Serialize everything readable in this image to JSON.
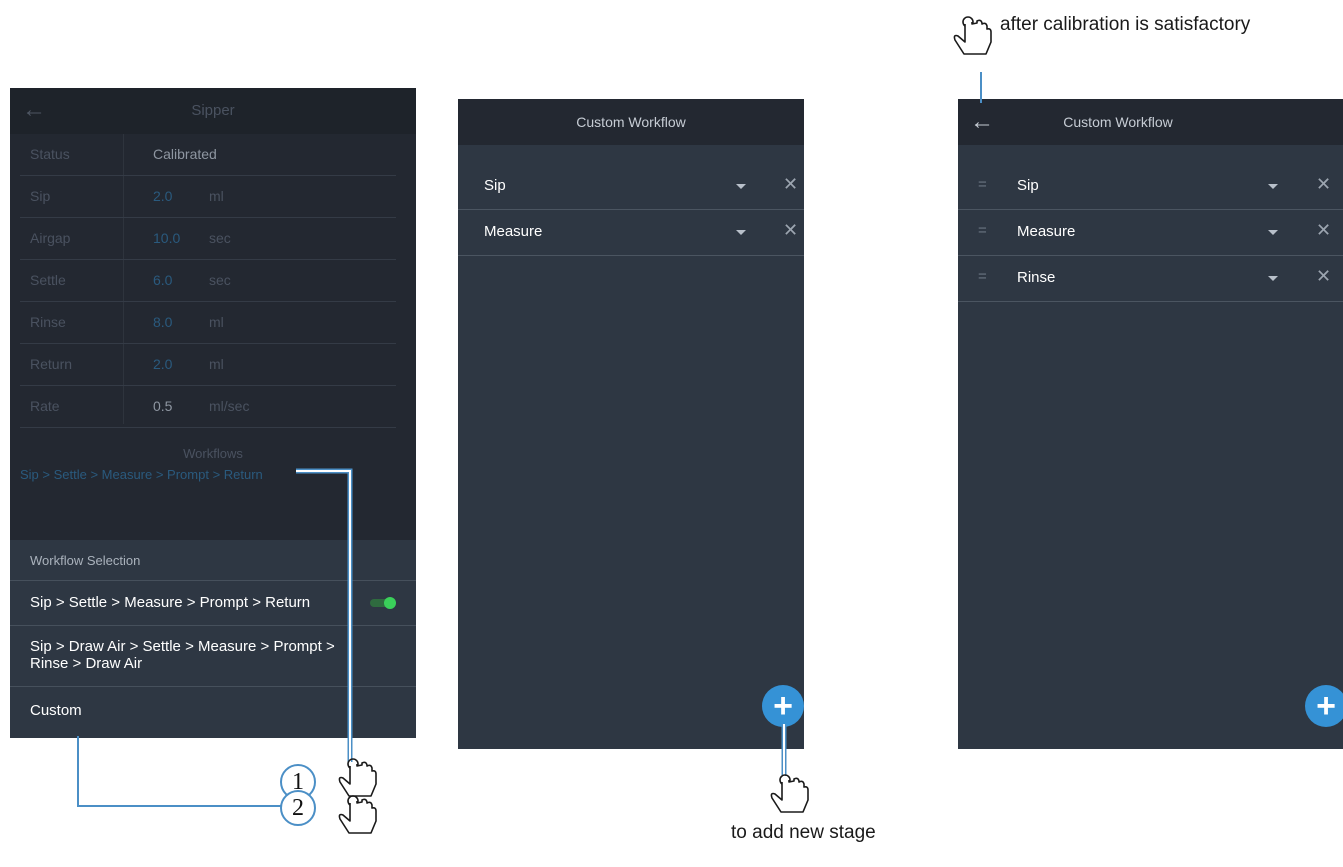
{
  "screen1": {
    "title": "Sipper",
    "params": [
      {
        "label": "Status",
        "value": "Calibrated",
        "unit": "",
        "kind": "status"
      },
      {
        "label": "Sip",
        "value": "2.0",
        "unit": "ml",
        "kind": "blue"
      },
      {
        "label": "Airgap",
        "value": "10.0",
        "unit": "sec",
        "kind": "blue"
      },
      {
        "label": "Settle",
        "value": "6.0",
        "unit": "sec",
        "kind": "blue"
      },
      {
        "label": "Rinse",
        "value": "8.0",
        "unit": "ml",
        "kind": "blue"
      },
      {
        "label": "Return",
        "value": "2.0",
        "unit": "ml",
        "kind": "blue"
      },
      {
        "label": "Rate",
        "value": "0.5",
        "unit": "ml/sec",
        "kind": "plain"
      }
    ],
    "workflows_title": "Workflows",
    "workflow_link": "Sip > Settle > Measure > Prompt > Return",
    "sheet": {
      "title": "Workflow Selection",
      "options": [
        {
          "label": "Sip > Settle > Measure > Prompt > Return",
          "enabled": true
        },
        {
          "label": "Sip > Draw Air > Settle > Measure > Prompt > Rinse > Draw Air"
        },
        {
          "label": "Custom"
        }
      ]
    }
  },
  "screen2": {
    "title": "Custom Workflow",
    "stages": [
      {
        "label": "Sip"
      },
      {
        "label": "Measure"
      }
    ],
    "fab": "+"
  },
  "screen3": {
    "title": "Custom Workflow",
    "stages": [
      {
        "label": "Sip"
      },
      {
        "label": "Measure"
      },
      {
        "label": "Rinse"
      }
    ],
    "fab": "+"
  },
  "annotations": {
    "callout1": "1",
    "callout2": "2",
    "add_stage": "to add new stage",
    "calibration": "after calibration is satisfactory"
  },
  "colors": {
    "accent_blue": "#3592d6",
    "toggle_green": "#3ad05a",
    "panel_dark": "#232831",
    "panel": "#2e3743",
    "callout_line": "#4b8fc6"
  },
  "icons": {
    "back": "arrow-left-icon",
    "dropdown": "caret-down-icon",
    "remove": "close-icon",
    "drag": "drag-handle-icon",
    "add": "plus-icon",
    "hand": "hand-tap-icon"
  }
}
